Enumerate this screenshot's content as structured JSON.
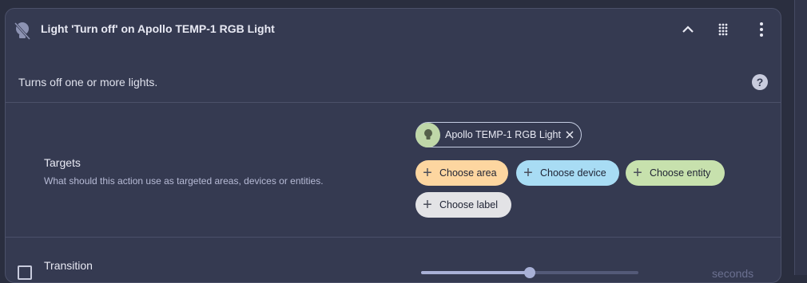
{
  "header": {
    "title": "Light 'Turn off' on Apollo TEMP-1 RGB Light"
  },
  "description": "Turns off one or more lights.",
  "targets": {
    "label": "Targets",
    "help": "What should this action use as targeted areas, devices or entities.",
    "selected_entity": "Apollo TEMP-1 RGB Light",
    "choose_area": "Choose area",
    "choose_device": "Choose device",
    "choose_entity": "Choose entity",
    "choose_label": "Choose label"
  },
  "transition": {
    "label": "Transition",
    "unit": "seconds",
    "slider_fraction": 0.5
  },
  "colors": {
    "area_chip": "#fdd6a0",
    "device_chip": "#a8dcf4",
    "entity_chip": "#c7e1ad",
    "label_chip": "#e3e3e6"
  },
  "icons": {
    "leading": "lightbulb-off-icon",
    "collapse": "chevron-up-icon",
    "drag": "drag-dots-icon",
    "menu": "more-vertical-icon",
    "help": "help-circle-icon",
    "entity": "lightbulb-icon",
    "remove": "close-icon",
    "add": "plus-icon"
  }
}
